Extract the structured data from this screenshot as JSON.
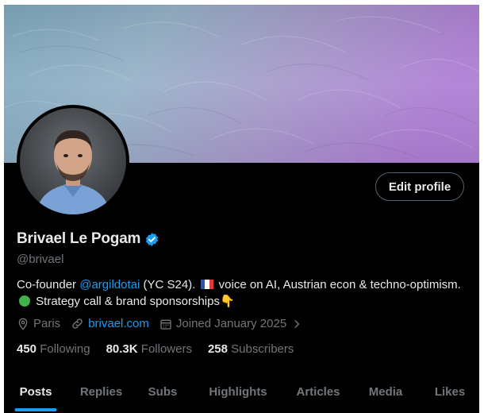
{
  "profile": {
    "name": "Brivael Le Pogam",
    "handle": "@brivael",
    "verified_color": "#1d9bf0",
    "edit_label": "Edit profile",
    "bio": {
      "part1": "Co-founder ",
      "mention": "@argildotai",
      "part2": " (YC S24). ",
      "flag": "france-flag",
      "part3": " voice on AI, Austrian econ & techno-optimism. ",
      "dot": "green-circle",
      "part4": " Strategy call & brand sponsorships",
      "emoji": "👇"
    },
    "location": "Paris",
    "website": "brivael.com",
    "joined": "Joined January 2025"
  },
  "stats": [
    {
      "value": "450",
      "label": "Following"
    },
    {
      "value": "80.3K",
      "label": "Followers"
    },
    {
      "value": "258",
      "label": "Subscribers"
    }
  ],
  "tabs": [
    {
      "label": "Posts",
      "active": true
    },
    {
      "label": "Replies",
      "active": false
    },
    {
      "label": "Subs",
      "active": false
    },
    {
      "label": "Highlights",
      "active": false
    },
    {
      "label": "Articles",
      "active": false
    },
    {
      "label": "Media",
      "active": false
    },
    {
      "label": "Likes",
      "active": false
    }
  ],
  "colors": {
    "accent": "#1d9bf0",
    "banner_left": "#8fb4c8",
    "banner_right": "#b48ad6",
    "secondary_text": "#71767b"
  }
}
